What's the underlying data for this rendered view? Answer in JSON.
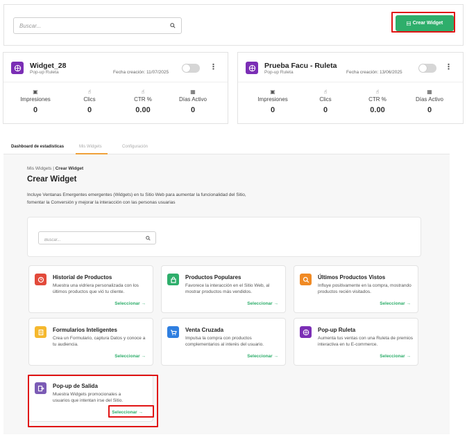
{
  "top_search": {
    "placeholder": "Buscar..."
  },
  "create_button": {
    "label": "Crear Widget"
  },
  "widgets": [
    {
      "name": "Widget_28",
      "type": "Pop-up Ruleta",
      "date": "Fecha creación: 11/07/2025",
      "stats": [
        {
          "label": "Impresiones",
          "value": "0"
        },
        {
          "label": "Clics",
          "value": "0"
        },
        {
          "label": "CTR %",
          "value": "0.00"
        },
        {
          "label": "Días Activo",
          "value": "0"
        }
      ]
    },
    {
      "name": "Prueba Facu - Ruleta",
      "type": "Pop-up Ruleta",
      "date": "Fecha creación: 13/06/2025",
      "stats": [
        {
          "label": "Impresiones",
          "value": "0"
        },
        {
          "label": "Clics",
          "value": "0"
        },
        {
          "label": "CTR %",
          "value": "0.00"
        },
        {
          "label": "Días Activo",
          "value": "0"
        }
      ]
    }
  ],
  "tabs": [
    "Dashboard de estadísticas",
    "Mis Widgets",
    "Configuración"
  ],
  "breadcrumb": {
    "parent": "Mis Widgets",
    "separator": "|",
    "current": "Crear Widget"
  },
  "page_title": "Crear Widget",
  "description": {
    "line1": "Incluye Ventanas Emergentes emergentes (Widgets) en tu Sitio Web para aumentar la funcionalidad del Sitio,",
    "line2": "fomentar la Conversión y mejorar la interacción con las personas usuarias"
  },
  "inner_search": {
    "placeholder": "Buscar..."
  },
  "select_label": "Seleccionar",
  "templates": [
    {
      "title": "Historial de Productos",
      "desc": "Muestra una vidriera personalizada con los últimos productos que vió tu cliente.",
      "color": "#e24a3b",
      "icon": "history-icon"
    },
    {
      "title": "Productos Populares",
      "desc": "Favorece la interacción en el Sitio Web, al mostrar productos más vendidos.",
      "color": "#2eae6b",
      "icon": "bag-icon"
    },
    {
      "title": "Últimos Productos Vistos",
      "desc": "Influye positivamente en la compra, mostrando productos recién visitados.",
      "color": "#f08a24",
      "icon": "magnifier-icon"
    },
    {
      "title": "Formularios Inteligentes",
      "desc": "Crea un Formulario, captura Datos y conoce a tu audiencia.",
      "color": "#f5b82e",
      "icon": "form-icon"
    },
    {
      "title": "Venta Cruzada",
      "desc": "Impulsa la compra con productos complementarios al interés del usuario.",
      "color": "#2f7fe0",
      "icon": "cart-icon"
    },
    {
      "title": "Pop-up Ruleta",
      "desc": "Aumenta tus ventas con una Ruleta de premios interactiva en tu E-commerce.",
      "color": "#7b2eb5",
      "icon": "wheel-icon"
    },
    {
      "title": "Pop-up de Salida",
      "desc": "Muestra Widgets promocionales a usuarios que intentan irse del Sitio.",
      "color": "#7b5bb5",
      "icon": "exit-icon"
    }
  ]
}
